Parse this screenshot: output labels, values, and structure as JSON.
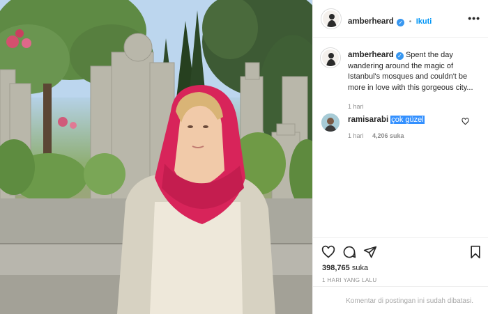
{
  "post": {
    "image_description_icon": "photo-of-woman-in-red-headscarf",
    "colors": {
      "accent": "#0095f6",
      "verified": "#3897f0",
      "text": "#262626",
      "muted": "#8e8e8e",
      "scarf": "#d8245a"
    }
  },
  "header": {
    "username": "amberheard",
    "separator": "•",
    "follow_label": "Ikuti",
    "more_icon": "more-dots-icon"
  },
  "caption": {
    "username": "amberheard",
    "text": "Spent the day wandering around the magic of Istanbul's mosques and couldn't be more in love with this gorgeous city...",
    "time": "1 hari"
  },
  "comment": {
    "username": "ramisarabi",
    "text": "çok güzel",
    "time": "1 hari",
    "likes": "4,206 suka"
  },
  "actions": {
    "like_icon": "heart-icon",
    "comment_icon": "comment-icon",
    "share_icon": "share-icon",
    "save_icon": "bookmark-icon",
    "likes_count": "398,765",
    "likes_suffix": " suka",
    "posted_time": "1 HARI YANG LALU",
    "comments_disabled": "Komentar di postingan ini sudah dibatasi."
  }
}
